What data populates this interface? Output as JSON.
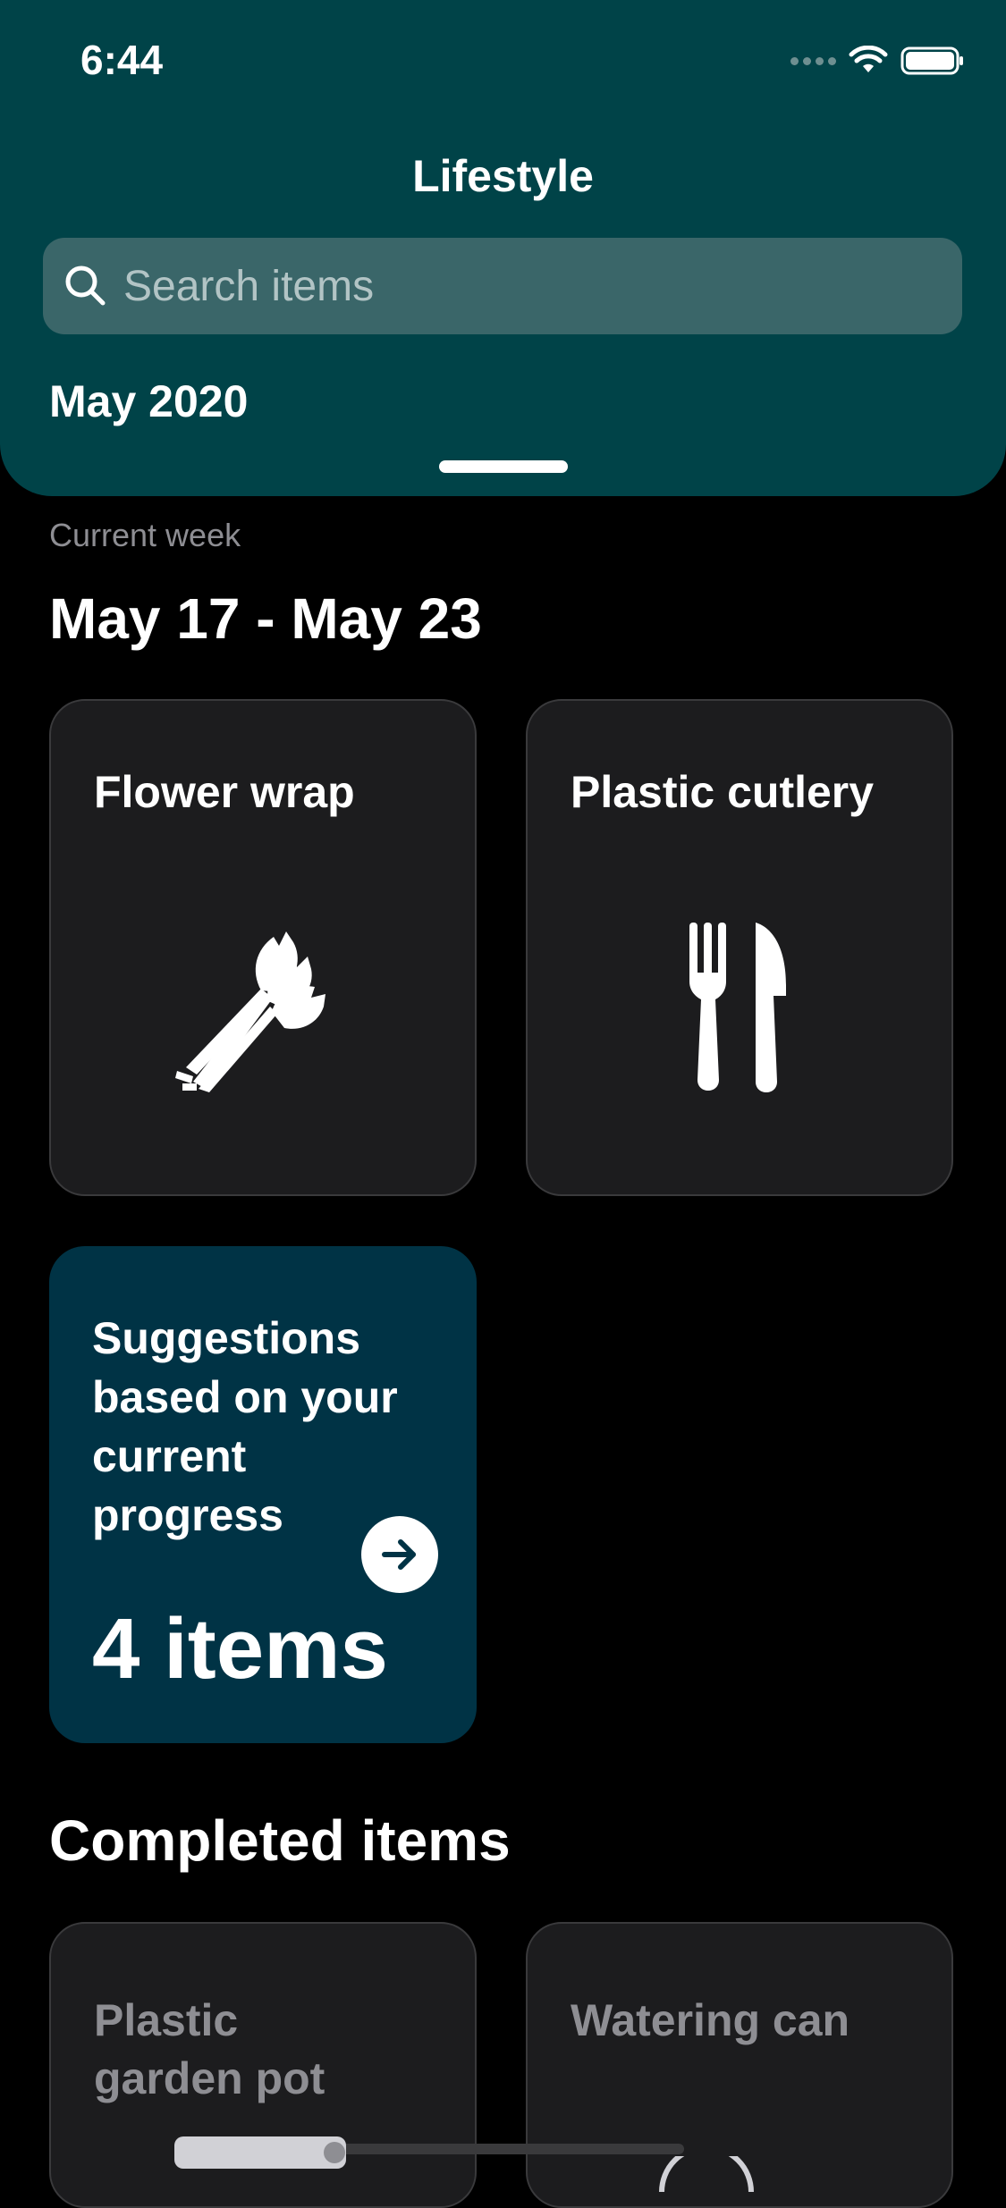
{
  "status_bar": {
    "time": "6:44"
  },
  "header": {
    "title": "Lifestyle",
    "search_placeholder": "Search items",
    "month": "May 2020"
  },
  "current_week": {
    "label": "Current week",
    "range": "May 17 - May 23",
    "items": [
      {
        "title": "Flower wrap",
        "icon": "flower-bouquet-icon"
      },
      {
        "title": "Plastic cutlery",
        "icon": "fork-knife-icon"
      }
    ]
  },
  "suggestions": {
    "text": "Suggestions based on your current progress",
    "count": "4 items",
    "icon": "arrow-right-circle-icon"
  },
  "completed": {
    "heading": "Completed items",
    "items": [
      {
        "title": "Plastic garden pot"
      },
      {
        "title": "Watering can"
      }
    ]
  },
  "colors": {
    "header_bg": "#004348",
    "search_bg": "#3a6669",
    "card_bg": "#1c1c1e",
    "suggest_bg": "#003345"
  }
}
